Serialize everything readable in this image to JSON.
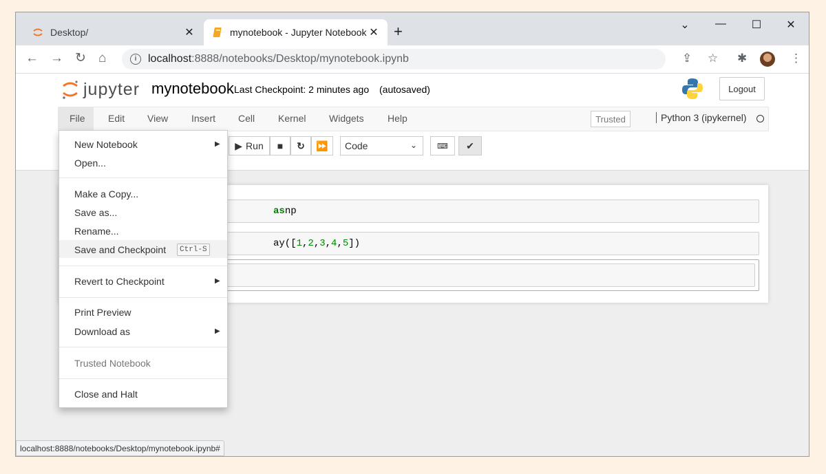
{
  "browser": {
    "tabs": [
      {
        "title": "Desktop/"
      },
      {
        "title": "mynotebook - Jupyter Notebook"
      }
    ],
    "url_host": "localhost",
    "url_path": ":8888/notebooks/Desktop/mynotebook.ipynb",
    "status_url": "localhost:8888/notebooks/Desktop/mynotebook.ipynb#"
  },
  "jupyter": {
    "logo_text": "jupyter",
    "notebook_name": "mynotebook",
    "checkpoint": "Last Checkpoint: 2 minutes ago",
    "autosaved": "(autosaved)",
    "logout_label": "Logout",
    "trusted_label": "Trusted",
    "kernel_name": "Python 3 (ipykernel)",
    "menu": [
      "File",
      "Edit",
      "View",
      "Insert",
      "Cell",
      "Kernel",
      "Widgets",
      "Help"
    ],
    "run_label": "Run",
    "cell_type": "Code"
  },
  "cells": {
    "c1_kw": "as",
    "c1_rest": " np",
    "c2_pre": "ay([",
    "c2_n1": "1",
    "c2_n2": "2",
    "c2_n3": "3",
    "c2_n4": "4",
    "c2_n5": "5",
    "c2_post": "])"
  },
  "file_menu": {
    "new_notebook": "New Notebook",
    "open": "Open...",
    "make_copy": "Make a Copy...",
    "save_as": "Save as...",
    "rename": "Rename...",
    "save_checkpoint": "Save and Checkpoint",
    "save_shortcut": "Ctrl-S",
    "revert": "Revert to Checkpoint",
    "print_preview": "Print Preview",
    "download_as": "Download as",
    "trusted_notebook": "Trusted Notebook",
    "close_halt": "Close and Halt"
  },
  "colors": {
    "jupyter_orange": "#f37726",
    "keyword_green": "#008000"
  }
}
